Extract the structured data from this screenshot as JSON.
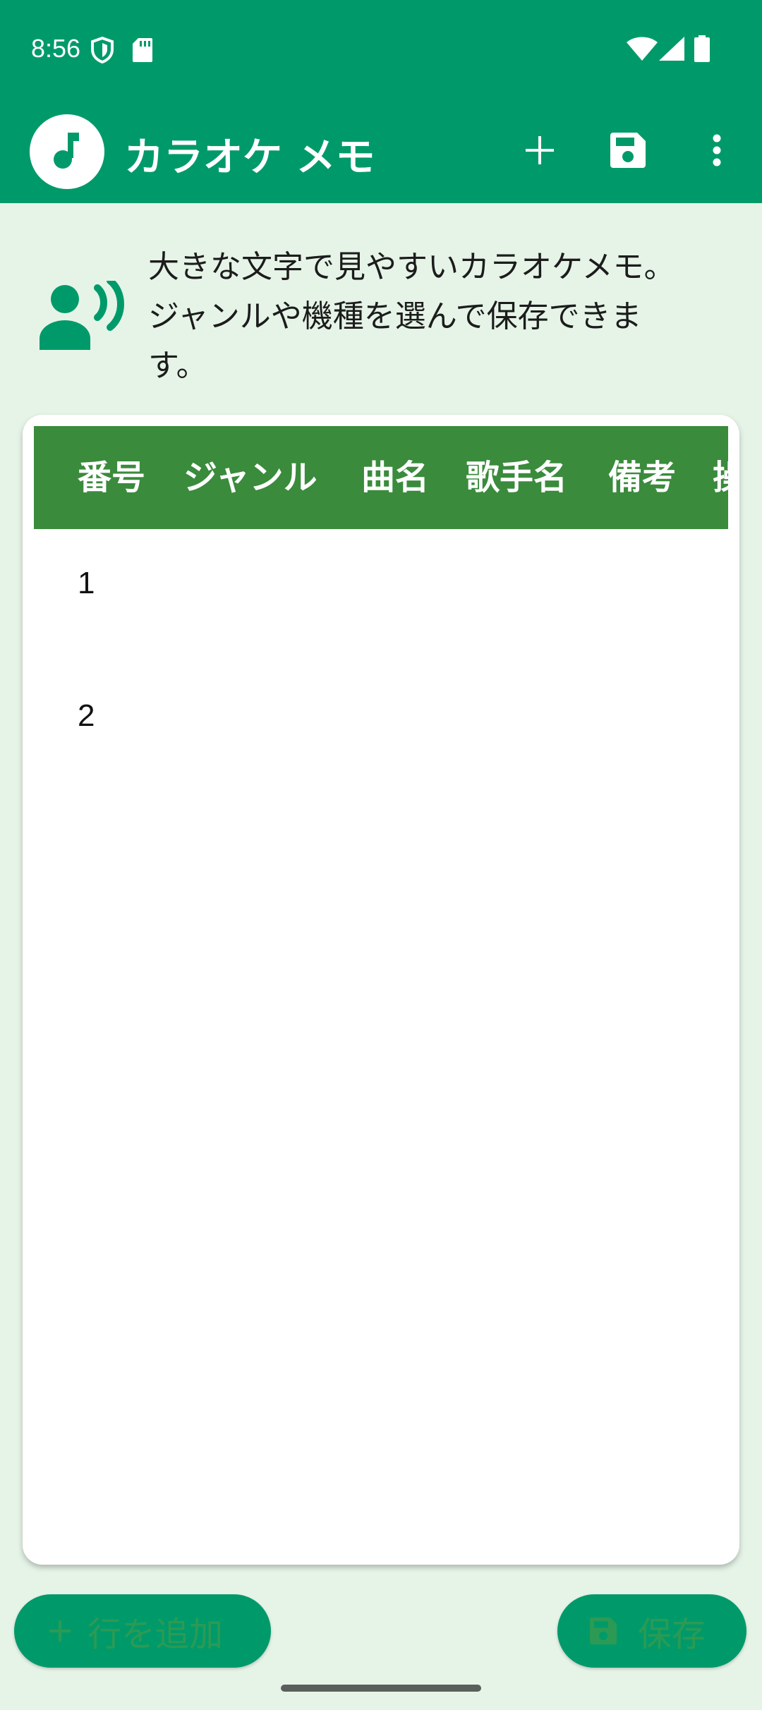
{
  "status_bar": {
    "time": "8:56",
    "icons": [
      "shield-icon",
      "sd-card-icon",
      "wifi-icon",
      "signal-icon",
      "battery-icon"
    ]
  },
  "app_bar": {
    "title": "カラオケ メモ",
    "logo_icon": "music-note-icon",
    "actions": [
      "add-icon",
      "save-icon",
      "more-vert-icon"
    ]
  },
  "info": {
    "icon": "voice-icon",
    "text": "大きな文字で見やすいカラオケメモ。ジャンルや機種を選んで保存できます。"
  },
  "table": {
    "columns": [
      "番号",
      "ジャンル",
      "曲名",
      "歌手名",
      "備考",
      "操"
    ],
    "rows": [
      {
        "number": "1"
      },
      {
        "number": "2"
      }
    ]
  },
  "buttons": {
    "add_label": "行を追加",
    "save_label": "保存"
  },
  "colors": {
    "primary": "#009a6a",
    "header_green": "#3a8b3c",
    "background": "#e6f4e8"
  }
}
